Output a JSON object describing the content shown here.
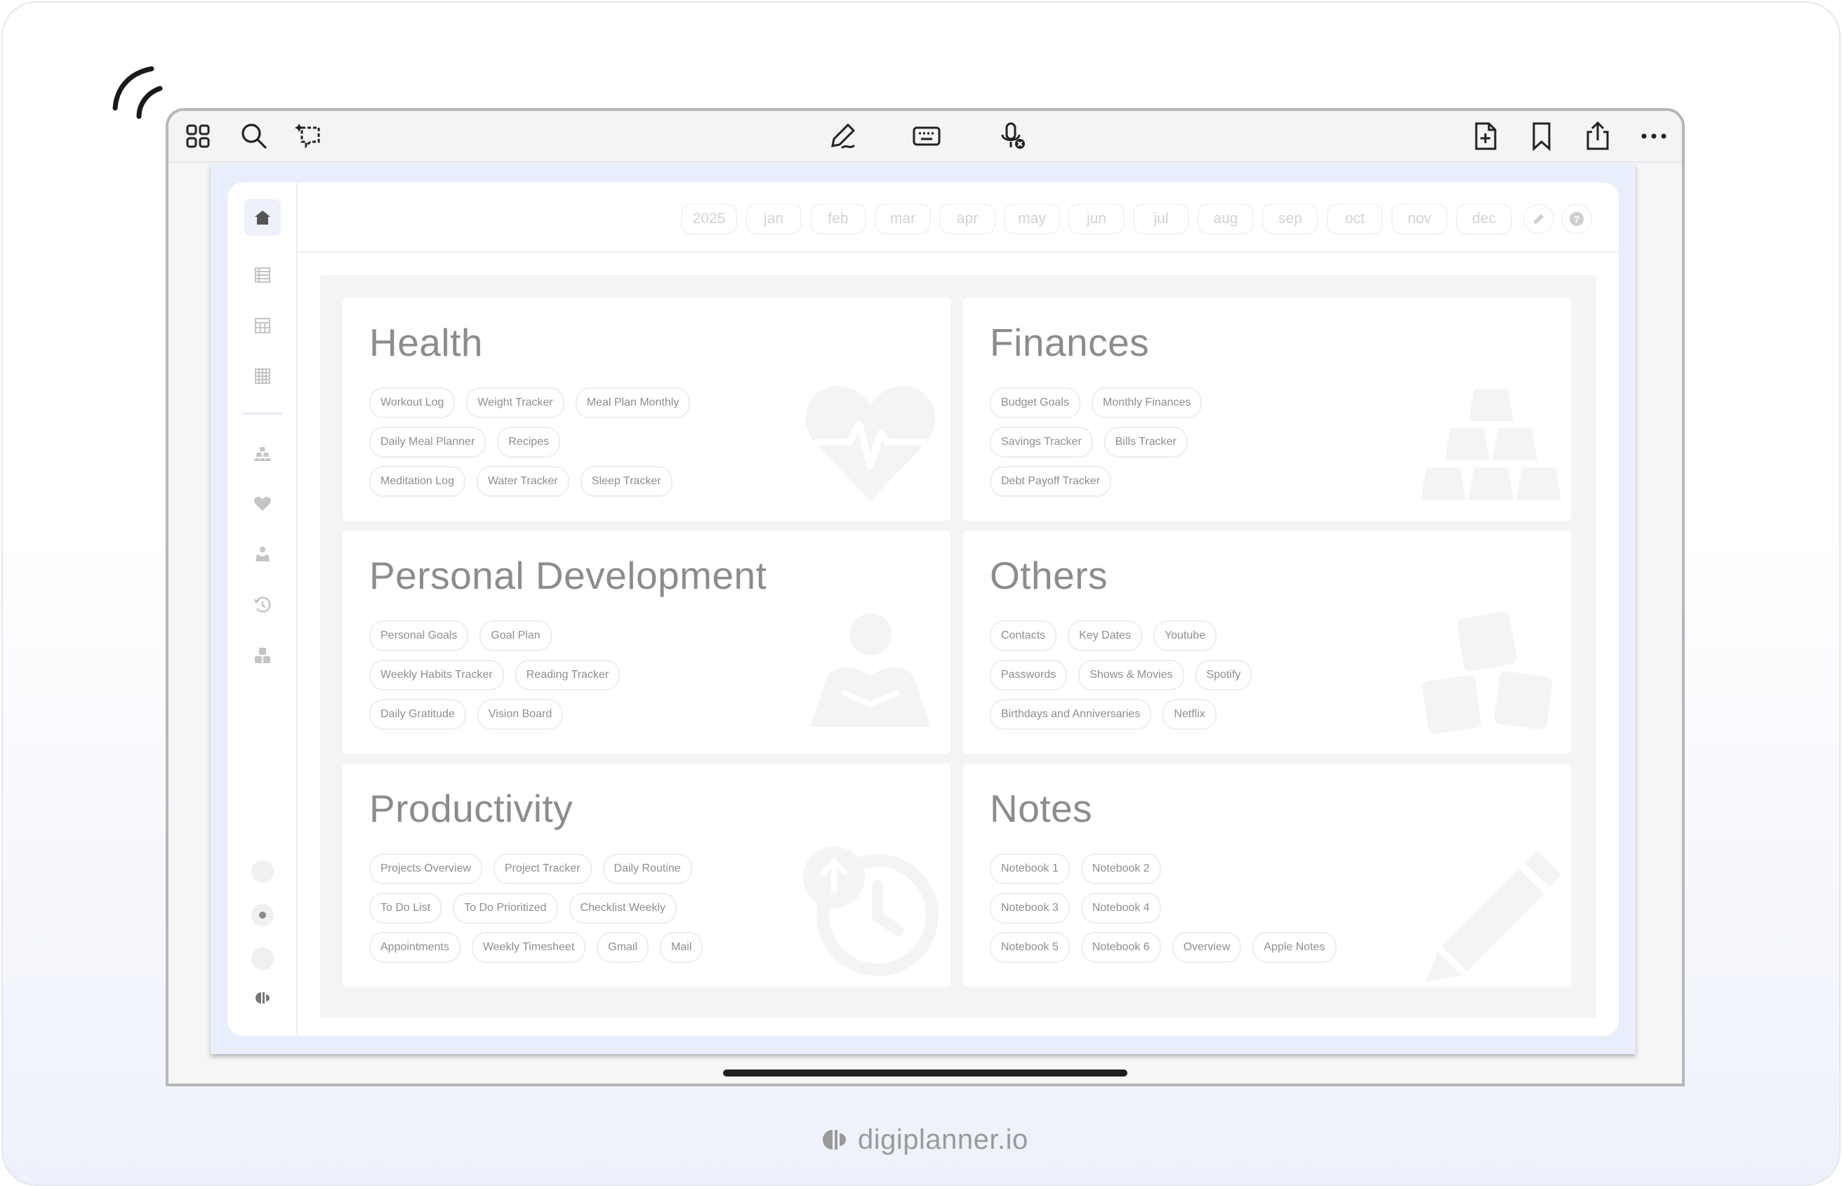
{
  "toolbar": {
    "left_icons": [
      "grid-icon",
      "search-icon",
      "lasso-icon"
    ],
    "center_icons": [
      "pen-icon",
      "keyboard-icon",
      "microphone-icon"
    ],
    "right_icons": [
      "add-page-icon",
      "bookmark-icon",
      "share-icon",
      "more-icon"
    ]
  },
  "sidebar": {
    "icons": [
      "home-icon",
      "weekly-layout-icon",
      "monthly-calendar-icon",
      "yearly-grid-icon",
      "finances-icon",
      "health-icon",
      "personal-development-icon",
      "productivity-icon",
      "others-icon"
    ],
    "dots": [
      "theme-dot-1",
      "theme-dot-2",
      "theme-dot-3"
    ],
    "logo": "digiplanner-logo-icon"
  },
  "timeline": {
    "year": "2025",
    "months": [
      "jan",
      "feb",
      "mar",
      "apr",
      "may",
      "jun",
      "jul",
      "aug",
      "sep",
      "oct",
      "nov",
      "dec"
    ]
  },
  "sections": [
    {
      "title": "Health",
      "art": "heart-pulse-icon",
      "rows": [
        [
          "Workout Log",
          "Weight Tracker",
          "Meal Plan Monthly"
        ],
        [
          "Daily Meal Planner",
          "Recipes"
        ],
        [
          "Meditation Log",
          "Water Tracker",
          "Sleep Tracker"
        ]
      ]
    },
    {
      "title": "Finances",
      "art": "gold-bars-icon",
      "rows": [
        [
          "Budget Goals",
          "Monthly Finances"
        ],
        [
          "Savings Tracker",
          "Bills Tracker"
        ],
        [
          "Debt Payoff Tracker"
        ]
      ]
    },
    {
      "title": "Personal Development",
      "art": "reading-person-icon",
      "rows": [
        [
          "Personal Goals",
          "Goal Plan"
        ],
        [
          "Weekly Habits Tracker",
          "Reading Tracker"
        ],
        [
          "Daily Gratitude",
          "Vision Board"
        ]
      ]
    },
    {
      "title": "Others",
      "art": "number-blocks-icon",
      "rows": [
        [
          "Contacts",
          "Key Dates",
          "Youtube"
        ],
        [
          "Passwords",
          "Shows & Movies",
          "Spotify"
        ],
        [
          "Birthdays and Anniversaries",
          "Netflix"
        ]
      ]
    },
    {
      "title": "Productivity",
      "art": "clock-history-icon",
      "rows": [
        [
          "Projects Overview",
          "Project Tracker",
          "Daily Routine"
        ],
        [
          "To Do List",
          "To Do Prioritized",
          "Checklist Weekly"
        ],
        [
          "Appointments",
          "Weekly Timesheet",
          "Gmail",
          "Mail"
        ]
      ]
    },
    {
      "title": "Notes",
      "art": "pencil-icon",
      "rows": [
        [
          "Notebook 1",
          "Notebook 2"
        ],
        [
          "Notebook 3",
          "Notebook 4"
        ],
        [
          "Notebook 5",
          "Notebook 6",
          "Overview",
          "Apple Notes"
        ]
      ]
    }
  ],
  "brand": {
    "name": "digiplanner.io"
  }
}
